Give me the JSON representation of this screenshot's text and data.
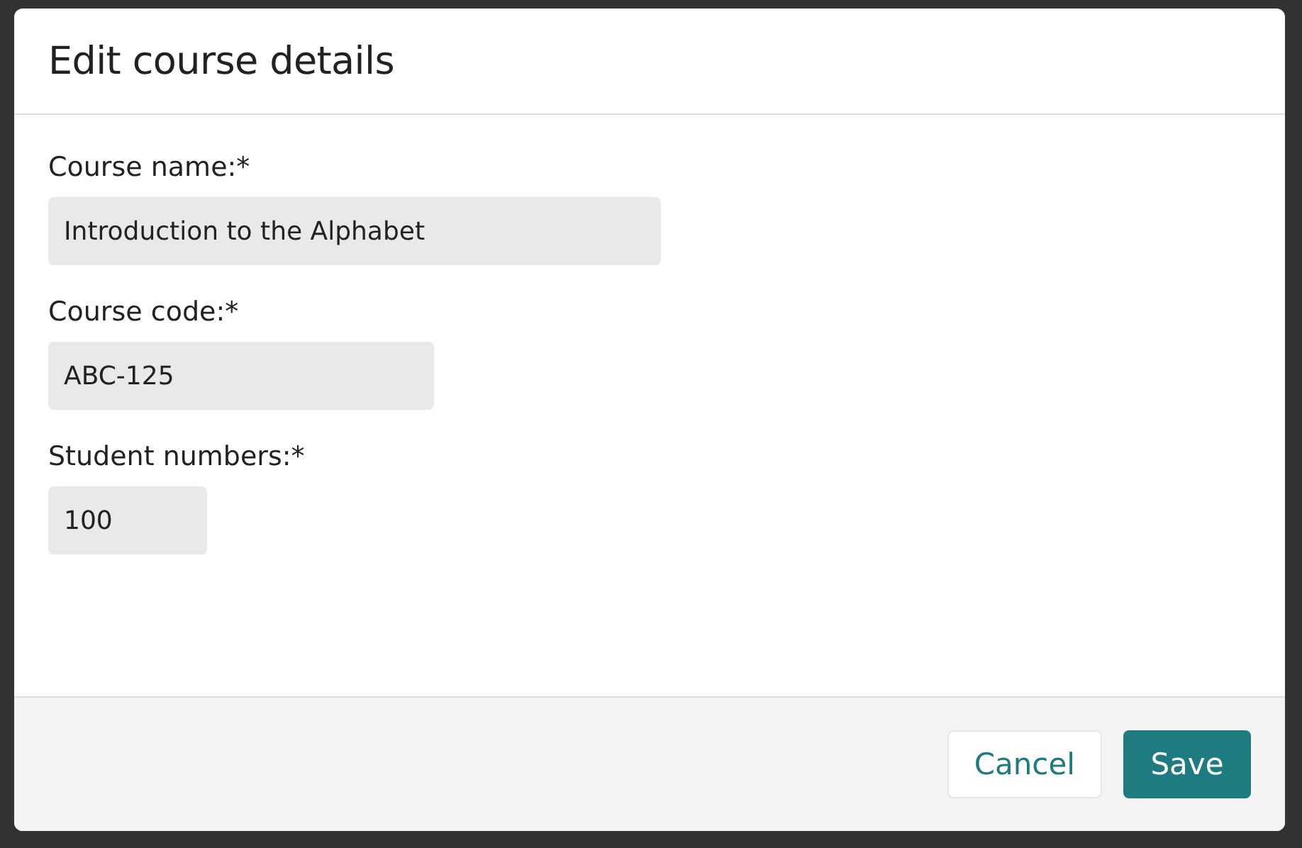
{
  "dialog": {
    "title": "Edit course details",
    "fields": [
      {
        "label": "Course name:*",
        "value": "Introduction to the Alphabet"
      },
      {
        "label": "Course code:*",
        "value": "ABC-125"
      },
      {
        "label": "Student numbers:*",
        "value": "100"
      }
    ],
    "buttons": [
      {
        "label": "Cancel",
        "kind": "secondary"
      },
      {
        "label": "Save",
        "kind": "primary"
      }
    ]
  }
}
